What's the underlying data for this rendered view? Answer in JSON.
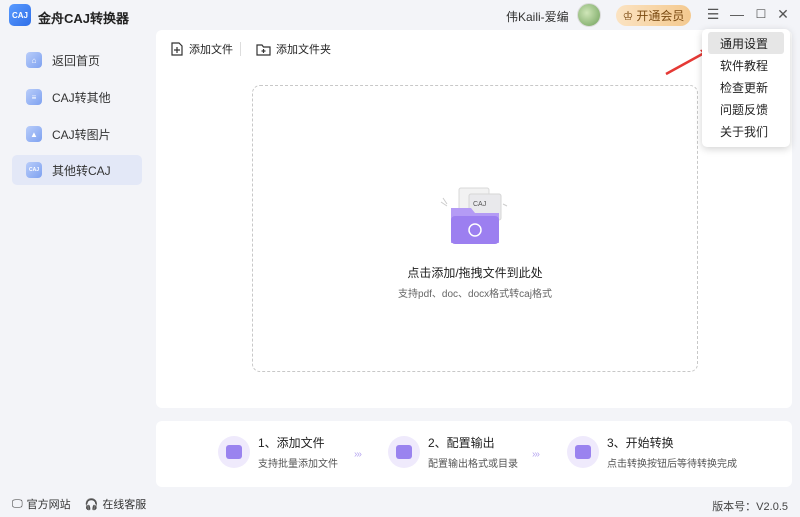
{
  "app": {
    "title": "金舟CAJ转换器",
    "logo_text": "CAJ",
    "username": "伟Kaili-爱编",
    "vip_button": "开通会员"
  },
  "sidebar": {
    "items": [
      {
        "label": "返回首页",
        "icon": "home-icon"
      },
      {
        "label": "CAJ转其他",
        "icon": "document-icon"
      },
      {
        "label": "CAJ转图片",
        "icon": "image-icon"
      },
      {
        "label": "其他转CAJ",
        "icon": "caj-icon",
        "active": true
      }
    ]
  },
  "toolbar": {
    "add_file": "添加文件",
    "add_folder": "添加文件夹"
  },
  "drop_zone": {
    "art_label": "CAJ",
    "title": "点击添加/拖拽文件到此处",
    "subtitle": "支持pdf、doc、docx格式转caj格式"
  },
  "steps": [
    {
      "title": "1、添加文件",
      "desc": "支持批量添加文件"
    },
    {
      "title": "2、配置输出",
      "desc": "配置输出格式或目录"
    },
    {
      "title": "3、开始转换",
      "desc": "点击转换按钮后等待转换完成"
    }
  ],
  "footer": {
    "official_site": "官方网站",
    "online_service": "在线客服",
    "version": "版本号：V2.0.5"
  },
  "menu": {
    "items": [
      "通用设置",
      "软件教程",
      "检查更新",
      "问题反馈",
      "关于我们"
    ],
    "highlighted_index": 0
  },
  "colors": {
    "accent": "#9a83ef",
    "active_bg": "#e3e8f7",
    "vip_gradient_start": "#fbe3c2",
    "annotation_arrow": "#e53935"
  }
}
